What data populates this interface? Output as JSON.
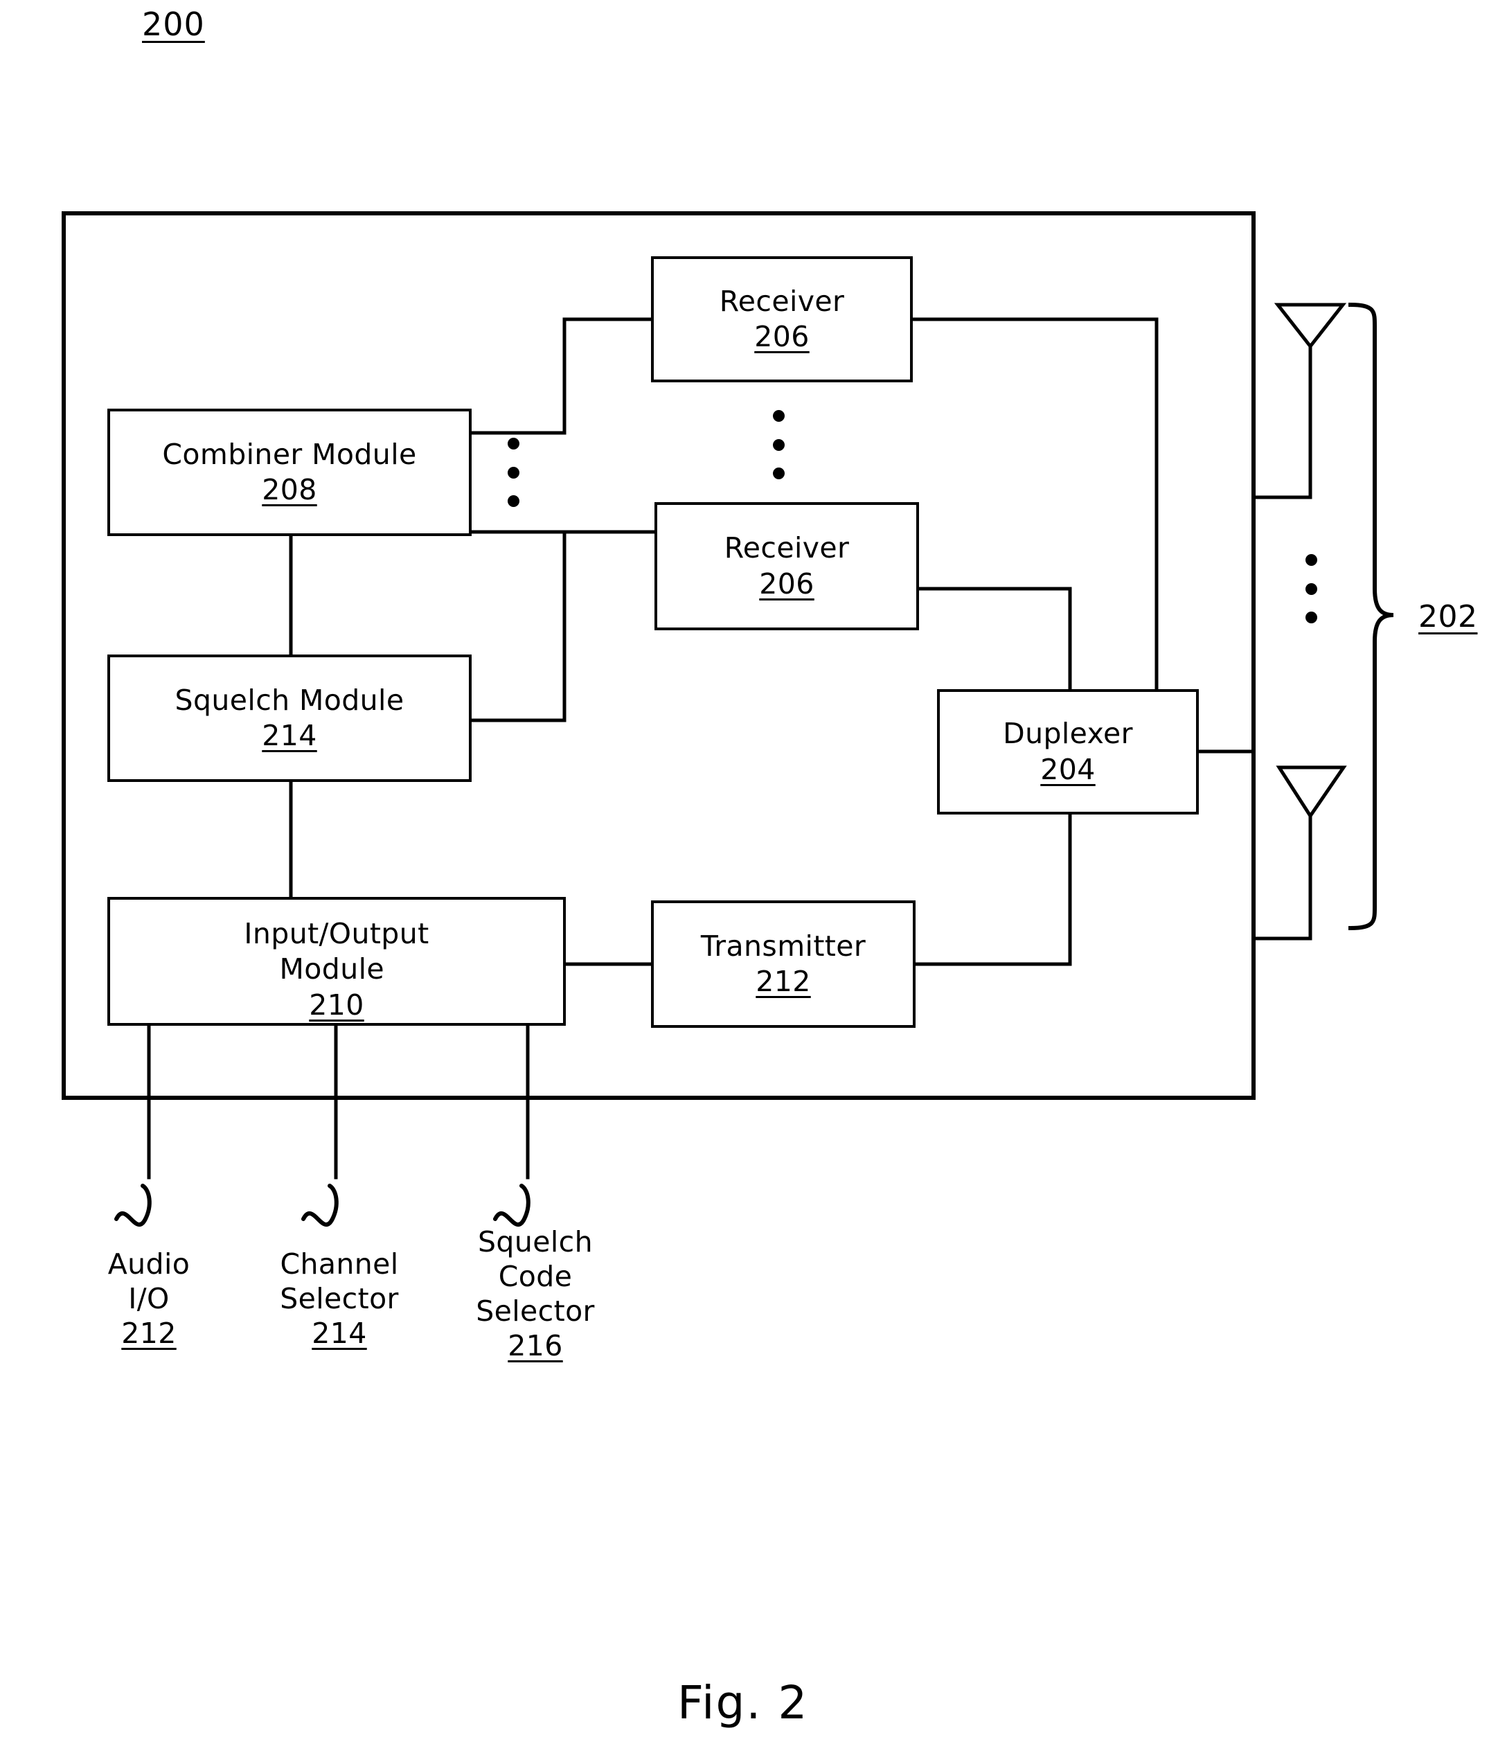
{
  "figure": {
    "number_label": "200",
    "caption": "Fig. 2"
  },
  "outer_enclosure": {
    "name": "radio-repeater-enclosure"
  },
  "blocks": [
    {
      "id": "receiver-top",
      "title": "Receiver",
      "ref": "206"
    },
    {
      "id": "receiver-bottom",
      "title": "Receiver",
      "ref": "206"
    },
    {
      "id": "combiner",
      "title": "Combiner Module",
      "ref": "208"
    },
    {
      "id": "squelch",
      "title": "Squelch Module",
      "ref": "214"
    },
    {
      "id": "io",
      "title_line1": "Input/Output",
      "title_line2": "Module ",
      "ref": "210"
    },
    {
      "id": "transmitter",
      "title": "Transmitter",
      "ref": "212"
    },
    {
      "id": "duplexer",
      "title": "Duplexer",
      "ref": "204"
    }
  ],
  "antenna_group": {
    "ref": "202",
    "count_indicator": "vertical-ellipsis"
  },
  "ellipses": {
    "combiner_ports": "vertical-ellipsis",
    "receivers": "vertical-ellipsis"
  },
  "terminals": [
    {
      "id": "audio-io",
      "lines": [
        "Audio",
        "I/O"
      ],
      "ref": "212"
    },
    {
      "id": "channel-selector",
      "lines": [
        "Channel",
        "Selector"
      ],
      "ref": "214"
    },
    {
      "id": "squelch-code-selector",
      "lines": [
        "Squelch",
        "Code",
        "Selector"
      ],
      "ref": "216"
    }
  ],
  "colors": {
    "ink": "#000000",
    "paper": "#ffffff"
  }
}
